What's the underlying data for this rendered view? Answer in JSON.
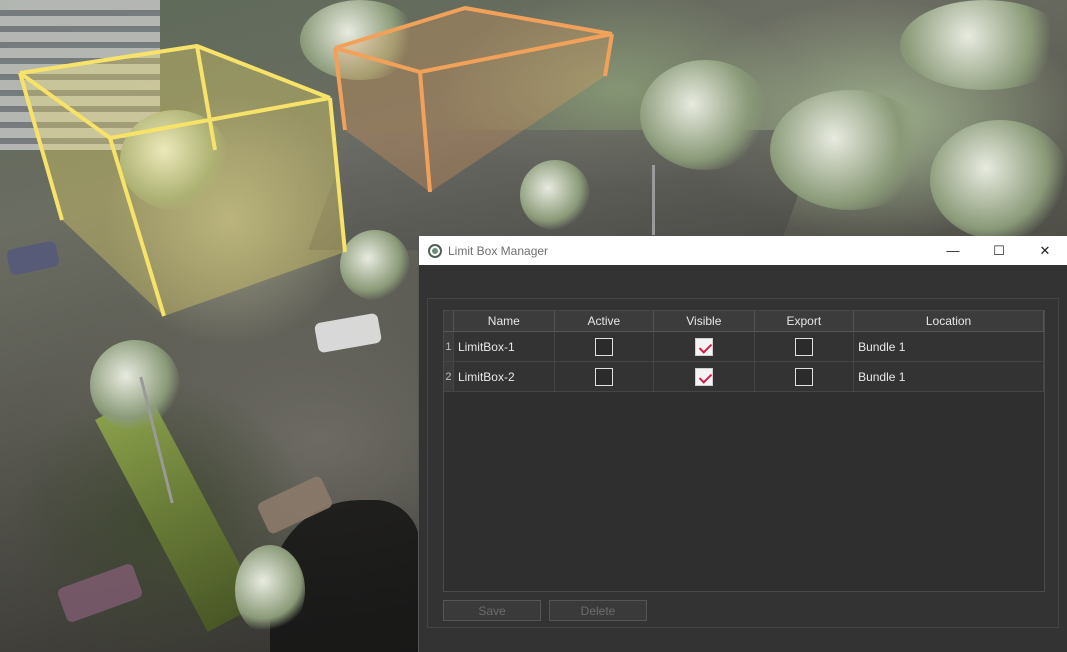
{
  "window": {
    "title": "Limit Box Manager",
    "minimize_glyph": "—",
    "maximize_glyph": "☐",
    "close_glyph": "✕"
  },
  "table": {
    "headers": [
      "Name",
      "Active",
      "Visible",
      "Export",
      "Location"
    ],
    "rows": [
      {
        "num": "1",
        "name": "LimitBox-1",
        "active": false,
        "visible": true,
        "export": false,
        "location": "Bundle 1"
      },
      {
        "num": "2",
        "name": "LimitBox-2",
        "active": false,
        "visible": true,
        "export": false,
        "location": "Bundle 1"
      }
    ]
  },
  "buttons": {
    "save": "Save",
    "delete": "Delete"
  },
  "colors": {
    "limit_box_1": "#f7e36a",
    "limit_box_2": "#f2a15a",
    "checkmark": "#d21f4a",
    "dialog_bg": "#333333"
  },
  "icons": {
    "app": "limit-box-app-icon"
  }
}
